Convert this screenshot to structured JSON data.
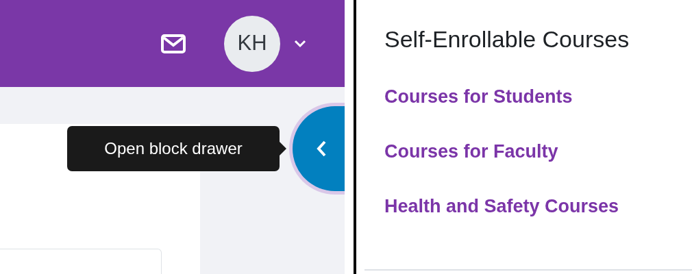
{
  "header": {
    "avatar_initials": "KH"
  },
  "drawer_button": {
    "tooltip": "Open block drawer"
  },
  "block": {
    "title": "Self-Enrollable Courses",
    "links": [
      {
        "label": "Courses for Students"
      },
      {
        "label": "Courses for Faculty"
      },
      {
        "label": "Health and Safety Courses"
      }
    ]
  }
}
